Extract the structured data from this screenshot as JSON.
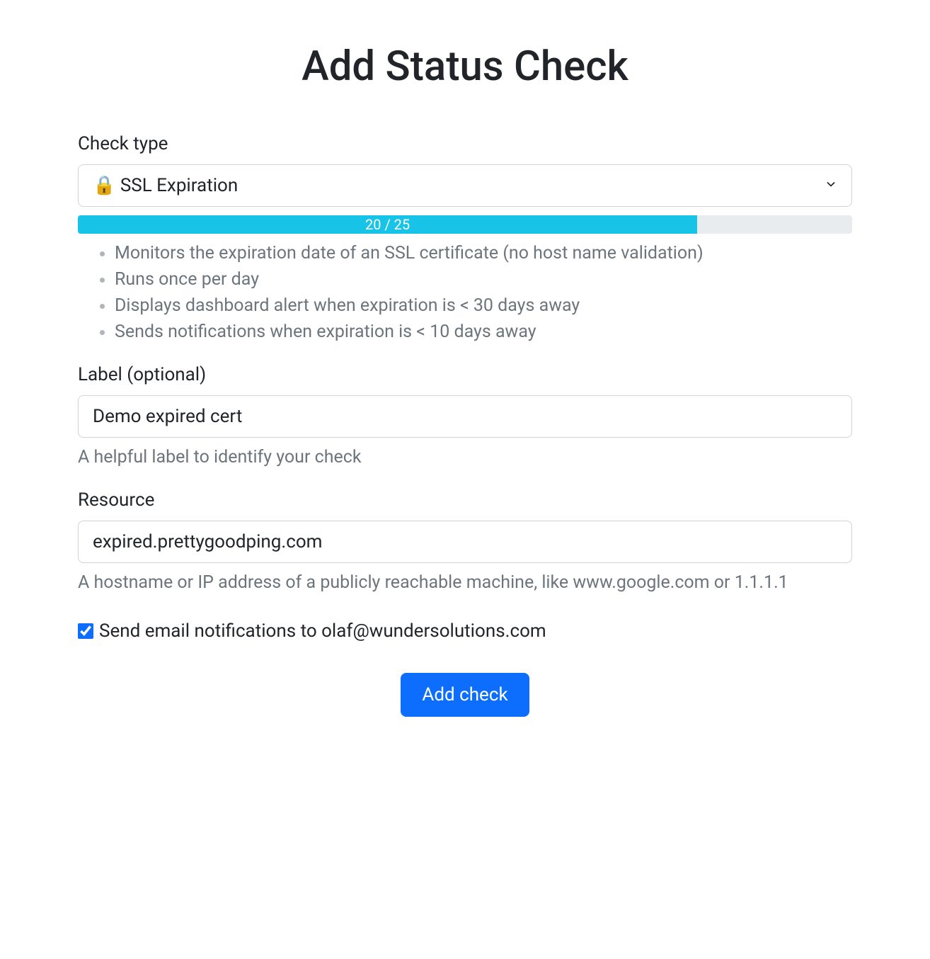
{
  "title": "Add Status Check",
  "check_type": {
    "label": "Check type",
    "selected": "🔒 SSL Expiration",
    "progress": {
      "current": 20,
      "max": 25,
      "text": "20 / 25",
      "percent": 80
    },
    "bullets": [
      "Monitors the expiration date of an SSL certificate (no host name validation)",
      "Runs once per day",
      "Displays dashboard alert when expiration is < 30 days away",
      "Sends notifications when expiration is < 10 days away"
    ]
  },
  "label_field": {
    "label": "Label (optional)",
    "value": "Demo expired cert",
    "help": "A helpful label to identify your check"
  },
  "resource_field": {
    "label": "Resource",
    "value": "expired.prettygoodping.com",
    "help": "A hostname or IP address of a publicly reachable machine, like www.google.com or 1.1.1.1"
  },
  "notifications": {
    "checked": true,
    "label": "Send email notifications to olaf@wundersolutions.com"
  },
  "submit": {
    "label": "Add check"
  }
}
